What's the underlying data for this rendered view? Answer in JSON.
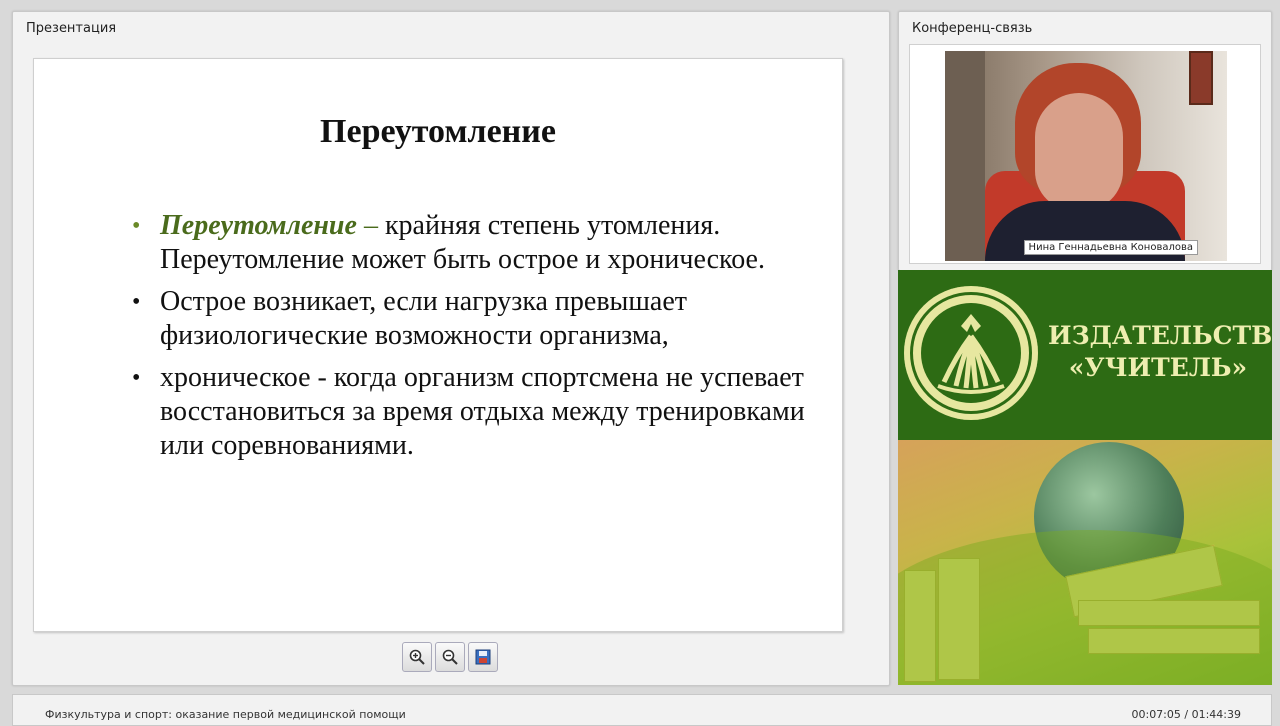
{
  "presentation_panel": {
    "title": "Презентация",
    "slide": {
      "title": "Переутомление",
      "bullets": [
        {
          "term": "Переутомление",
          "dash": " – ",
          "text": "крайняя степень утомления. Переутомление может быть острое и хроническое."
        },
        {
          "text": "Острое возникает, если нагрузка превышает физиологические возможности организма,"
        },
        {
          "text": "хроническое - когда организм спортсмена не успевает восстановиться за время отдыха между тренировками или соревнованиями."
        }
      ]
    },
    "toolbar": {
      "zoom_in_icon": "zoom-in-icon",
      "zoom_out_icon": "zoom-out-icon",
      "save_icon": "save-icon"
    }
  },
  "conference_panel": {
    "title": "Конференц-связь",
    "speaker_name": "Нина Геннадьевна Коновалова"
  },
  "ad": {
    "publisher_line1": "ИЗДАТЕЛЬСТВО",
    "publisher_line2": "«УЧИТЕЛЬ»",
    "colors": {
      "green": "#2d6b14",
      "cream": "#eeeeb0"
    }
  },
  "footer": {
    "course_title": "Физкультура и спорт: оказание первой медицинской помощи",
    "time": "00:07:05 / 01:44:39"
  }
}
